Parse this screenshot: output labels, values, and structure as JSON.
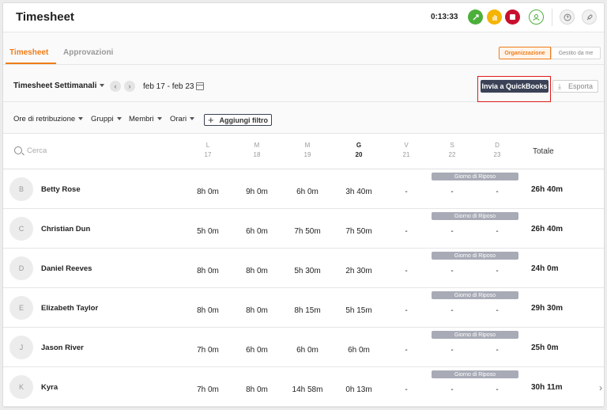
{
  "header": {
    "title": "Timesheet",
    "timer": "0:13:33",
    "icons": [
      "switch-icon",
      "hand-icon",
      "stop-icon",
      "user-icon",
      "help-icon",
      "rocket-icon"
    ]
  },
  "tabs": {
    "timesheet": "Timesheet",
    "approvals": "Approvazioni",
    "scope_org": "Organizzazione",
    "scope_me": "Gestito da me"
  },
  "controls": {
    "period": "Timesheet Settimanali",
    "daterange": "feb 17 - feb 23",
    "quickbooks": "Invia a QuickBooks",
    "export": "Esporta"
  },
  "filters": {
    "pay": "Ore di retribuzione",
    "groups": "Gruppi",
    "members": "Membri",
    "schedules": "Orari",
    "add": "Aggiungi filtro"
  },
  "table": {
    "search_placeholder": "Cerca",
    "total_header": "Totale",
    "rest_label": "Giorno di Riposo",
    "days": [
      {
        "letter": "L",
        "num": "17"
      },
      {
        "letter": "M",
        "num": "18"
      },
      {
        "letter": "M",
        "num": "19"
      },
      {
        "letter": "G",
        "num": "20"
      },
      {
        "letter": "V",
        "num": "21"
      },
      {
        "letter": "S",
        "num": "22"
      },
      {
        "letter": "D",
        "num": "23"
      }
    ],
    "rows": [
      {
        "initial": "B",
        "name": "Betty Rose",
        "hours": [
          "8h 0m",
          "9h 0m",
          "6h 0m",
          "3h 40m",
          "-",
          "-",
          "-"
        ],
        "total": "26h 40m"
      },
      {
        "initial": "C",
        "name": "Christian Dun",
        "hours": [
          "5h 0m",
          "6h 0m",
          "7h 50m",
          "7h 50m",
          "-",
          "-",
          "-"
        ],
        "total": "26h 40m"
      },
      {
        "initial": "D",
        "name": "Daniel Reeves",
        "hours": [
          "8h 0m",
          "8h 0m",
          "5h 30m",
          "2h 30m",
          "-",
          "-",
          "-"
        ],
        "total": "24h 0m"
      },
      {
        "initial": "E",
        "name": "Elizabeth Taylor",
        "hours": [
          "8h 0m",
          "8h 0m",
          "8h 15m",
          "5h 15m",
          "-",
          "-",
          "-"
        ],
        "total": "29h 30m"
      },
      {
        "initial": "J",
        "name": "Jason River",
        "hours": [
          "7h 0m",
          "6h 0m",
          "6h 0m",
          "6h 0m",
          "-",
          "-",
          "-"
        ],
        "total": "25h 0m"
      },
      {
        "initial": "K",
        "name": "Kyra",
        "hours": [
          "7h 0m",
          "8h 0m",
          "14h 58m",
          "0h 13m",
          "-",
          "-",
          "-"
        ],
        "total": "30h 11m"
      }
    ]
  }
}
